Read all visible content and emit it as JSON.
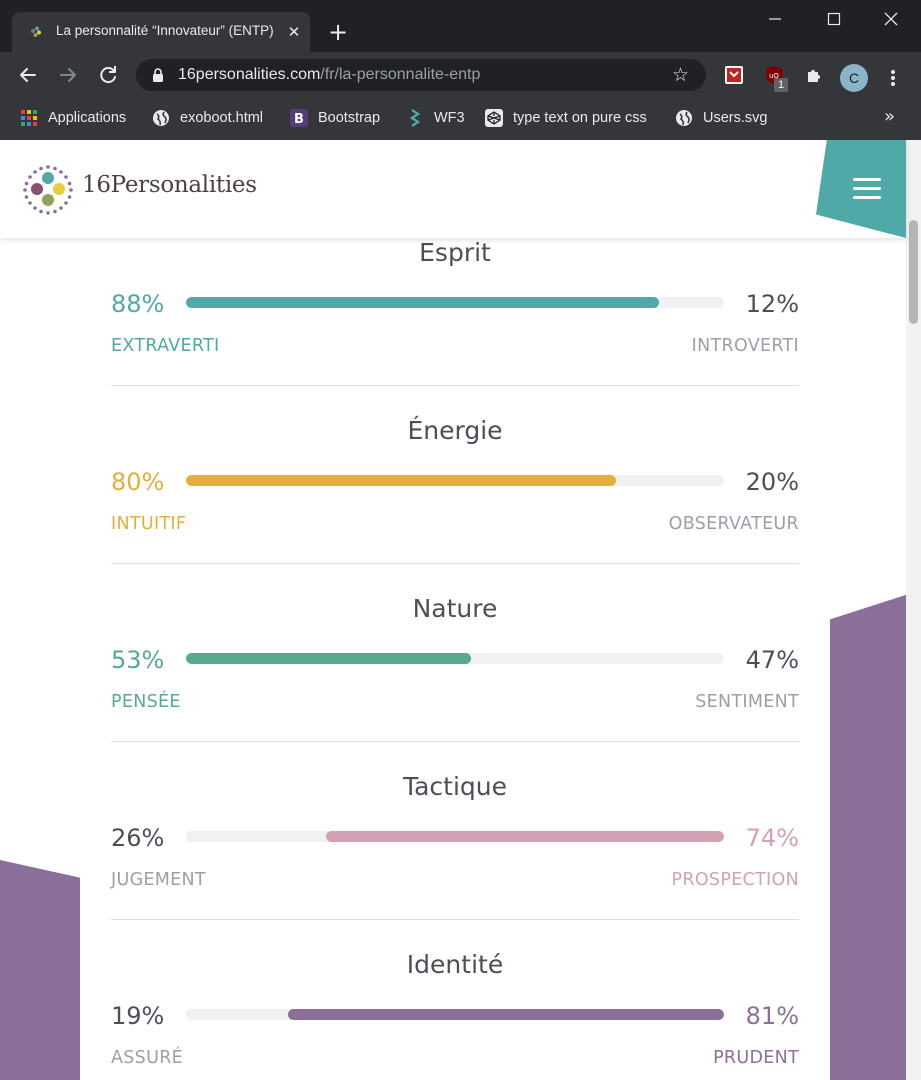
{
  "browser": {
    "tab_title": "La personnalité “Innovateur” (ENTP)",
    "tab_close": "✕",
    "new_tab": "+",
    "url_host": "16personalities.com",
    "url_path": "/fr/la-personnalite-entp",
    "profile_initial": "C",
    "extension_badge": "1",
    "bookmarks": [
      {
        "label": "Applications",
        "icon": "apps-grid-icon"
      },
      {
        "label": "exoboot.html",
        "icon": "globe-icon"
      },
      {
        "label": "Bootstrap",
        "icon": "bootstrap-icon"
      },
      {
        "label": "WF3",
        "icon": "wf3-icon"
      },
      {
        "label": "type text on pure css",
        "icon": "codepen-icon"
      },
      {
        "label": "Users.svg",
        "icon": "globe-icon"
      }
    ],
    "bookmarks_more": "»"
  },
  "site": {
    "logo_number": "16",
    "logo_word": "Personalities"
  },
  "traits": [
    {
      "name": "Esprit",
      "left_pct": "88%",
      "right_pct": "12%",
      "left_label": "EXTRAVERTI",
      "right_label": "INTROVERTI",
      "fill": 0.88,
      "side": "left",
      "color": "#4ea9a7"
    },
    {
      "name": "Énergie",
      "left_pct": "80%",
      "right_pct": "20%",
      "left_label": "INTUITIF",
      "right_label": "OBSERVATEUR",
      "fill": 0.8,
      "side": "left",
      "color": "#e4ae3a"
    },
    {
      "name": "Nature",
      "left_pct": "53%",
      "right_pct": "47%",
      "left_label": "PENSÉE",
      "right_label": "SENTIMENT",
      "fill": 0.53,
      "side": "left",
      "color": "#56ab8c"
    },
    {
      "name": "Tactique",
      "left_pct": "26%",
      "right_pct": "74%",
      "left_label": "JUGEMENT",
      "right_label": "PROSPECTION",
      "fill": 0.74,
      "side": "right",
      "color": "#d4a1b4"
    },
    {
      "name": "Identité",
      "left_pct": "19%",
      "right_pct": "81%",
      "left_label": "ASSURÉ",
      "right_label": "PRUDENT",
      "fill": 0.81,
      "side": "right",
      "color": "#8a7098"
    }
  ]
}
